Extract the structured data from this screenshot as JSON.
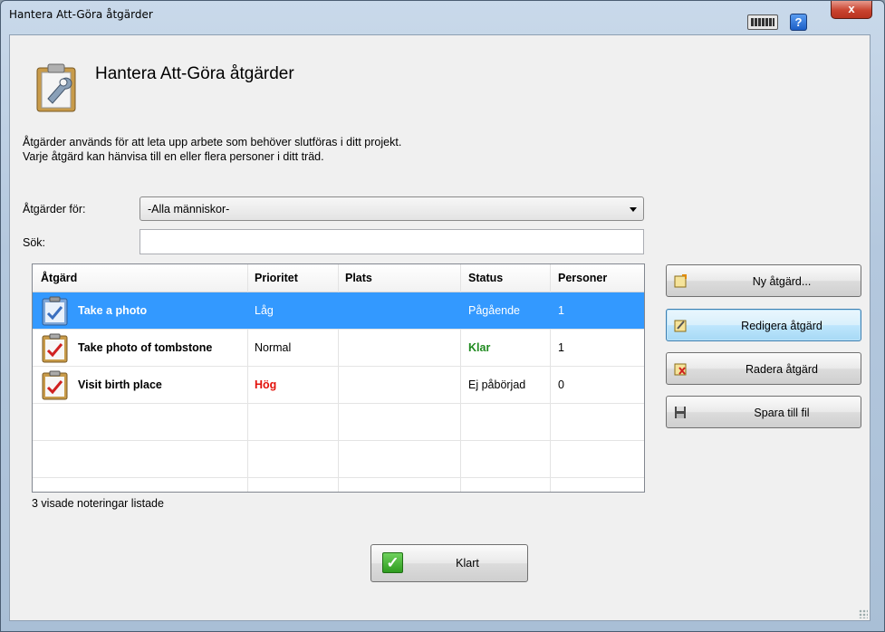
{
  "window": {
    "title": "Hantera Att-Göra åtgärder",
    "close_label": "x",
    "help_label": "?"
  },
  "header": {
    "title": "Hantera Att-Göra åtgärder",
    "desc_line1": "Åtgärder används för att leta upp arbete som behöver slutföras i ditt projekt.",
    "desc_line2": "Varje åtgärd kan hänvisa till en eller flera personer i ditt träd."
  },
  "filter": {
    "label": "Åtgärder för:",
    "selected": "-Alla människor-",
    "search_label": "Sök:",
    "search_value": ""
  },
  "table": {
    "columns": [
      "Åtgärd",
      "Prioritet",
      "Plats",
      "Status",
      "Personer"
    ],
    "rows": [
      {
        "name": "Take a photo",
        "priority": "Låg",
        "place": "",
        "status": "Pågående",
        "persons": "1"
      },
      {
        "name": "Take photo of tombstone",
        "priority": "Normal",
        "place": "",
        "status": "Klar",
        "persons": "1"
      },
      {
        "name": "Visit birth place",
        "priority": "Hög",
        "place": "",
        "status": "Ej påbörjad",
        "persons": "0"
      }
    ]
  },
  "count_text": "3 visade noteringar listade",
  "buttons": {
    "new": "Ny åtgärd...",
    "edit": "Redigera åtgärd",
    "delete": "Radera åtgärd",
    "save": "Spara till fil",
    "done": "Klart"
  },
  "colors": {
    "selection": "#3399ff",
    "priority_high": "#e3120b",
    "status_done": "#1f8a1f"
  }
}
